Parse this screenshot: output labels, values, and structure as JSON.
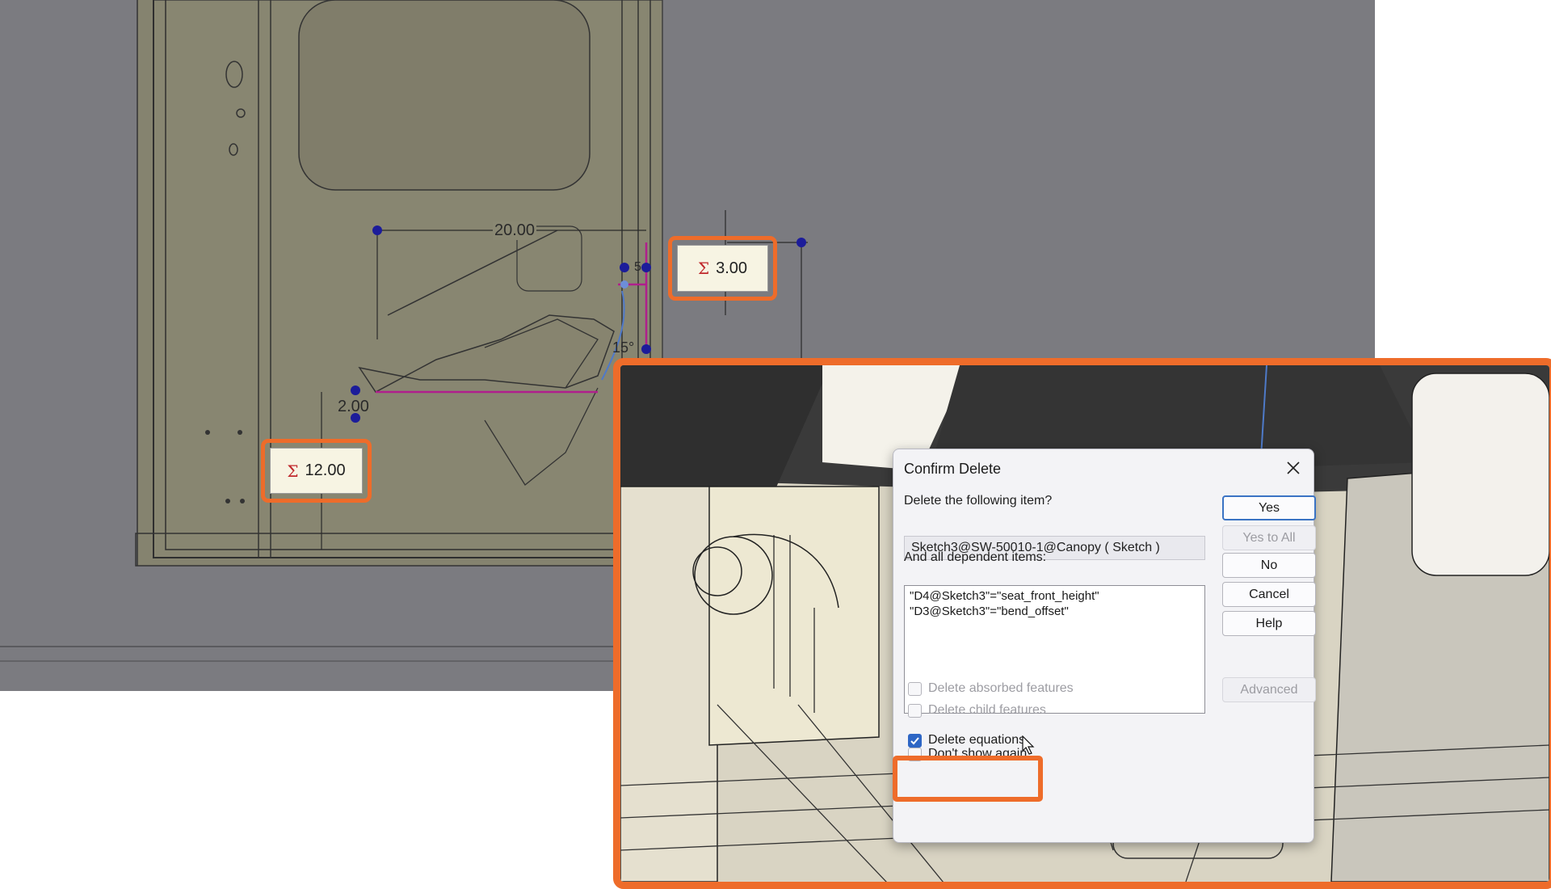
{
  "accent_color": "#ee6c2a",
  "background_view": {
    "dimensions": [
      "20.00",
      "2.00",
      "15°",
      "5"
    ],
    "equation_callouts": [
      {
        "icon": "sigma-icon",
        "symbol": "Σ",
        "value": "3.00"
      },
      {
        "icon": "sigma-icon",
        "symbol": "Σ",
        "value": "12.00"
      }
    ]
  },
  "dialog": {
    "title": "Confirm Delete",
    "question": "Delete the following item?",
    "item": "Sketch3@SW-50010-1@Canopy ( Sketch )",
    "dependents_label": "And all dependent items:",
    "dependents": [
      "\"D4@Sketch3\"=\"seat_front_height\"",
      "\"D3@Sketch3\"=\"bend_offset\""
    ],
    "buttons": {
      "yes": "Yes",
      "yes_to_all": "Yes to All",
      "no": "No",
      "cancel": "Cancel",
      "help": "Help",
      "advanced": "Advanced"
    },
    "options": {
      "absorbed": {
        "label": "Delete absorbed features",
        "checked": false,
        "enabled": false
      },
      "child": {
        "label": "Delete child features",
        "checked": false,
        "enabled": false
      },
      "equations": {
        "label": "Delete equations",
        "checked": true,
        "enabled": true
      },
      "dont_show": {
        "label": "Don't show again",
        "checked": false,
        "enabled": true
      }
    }
  }
}
